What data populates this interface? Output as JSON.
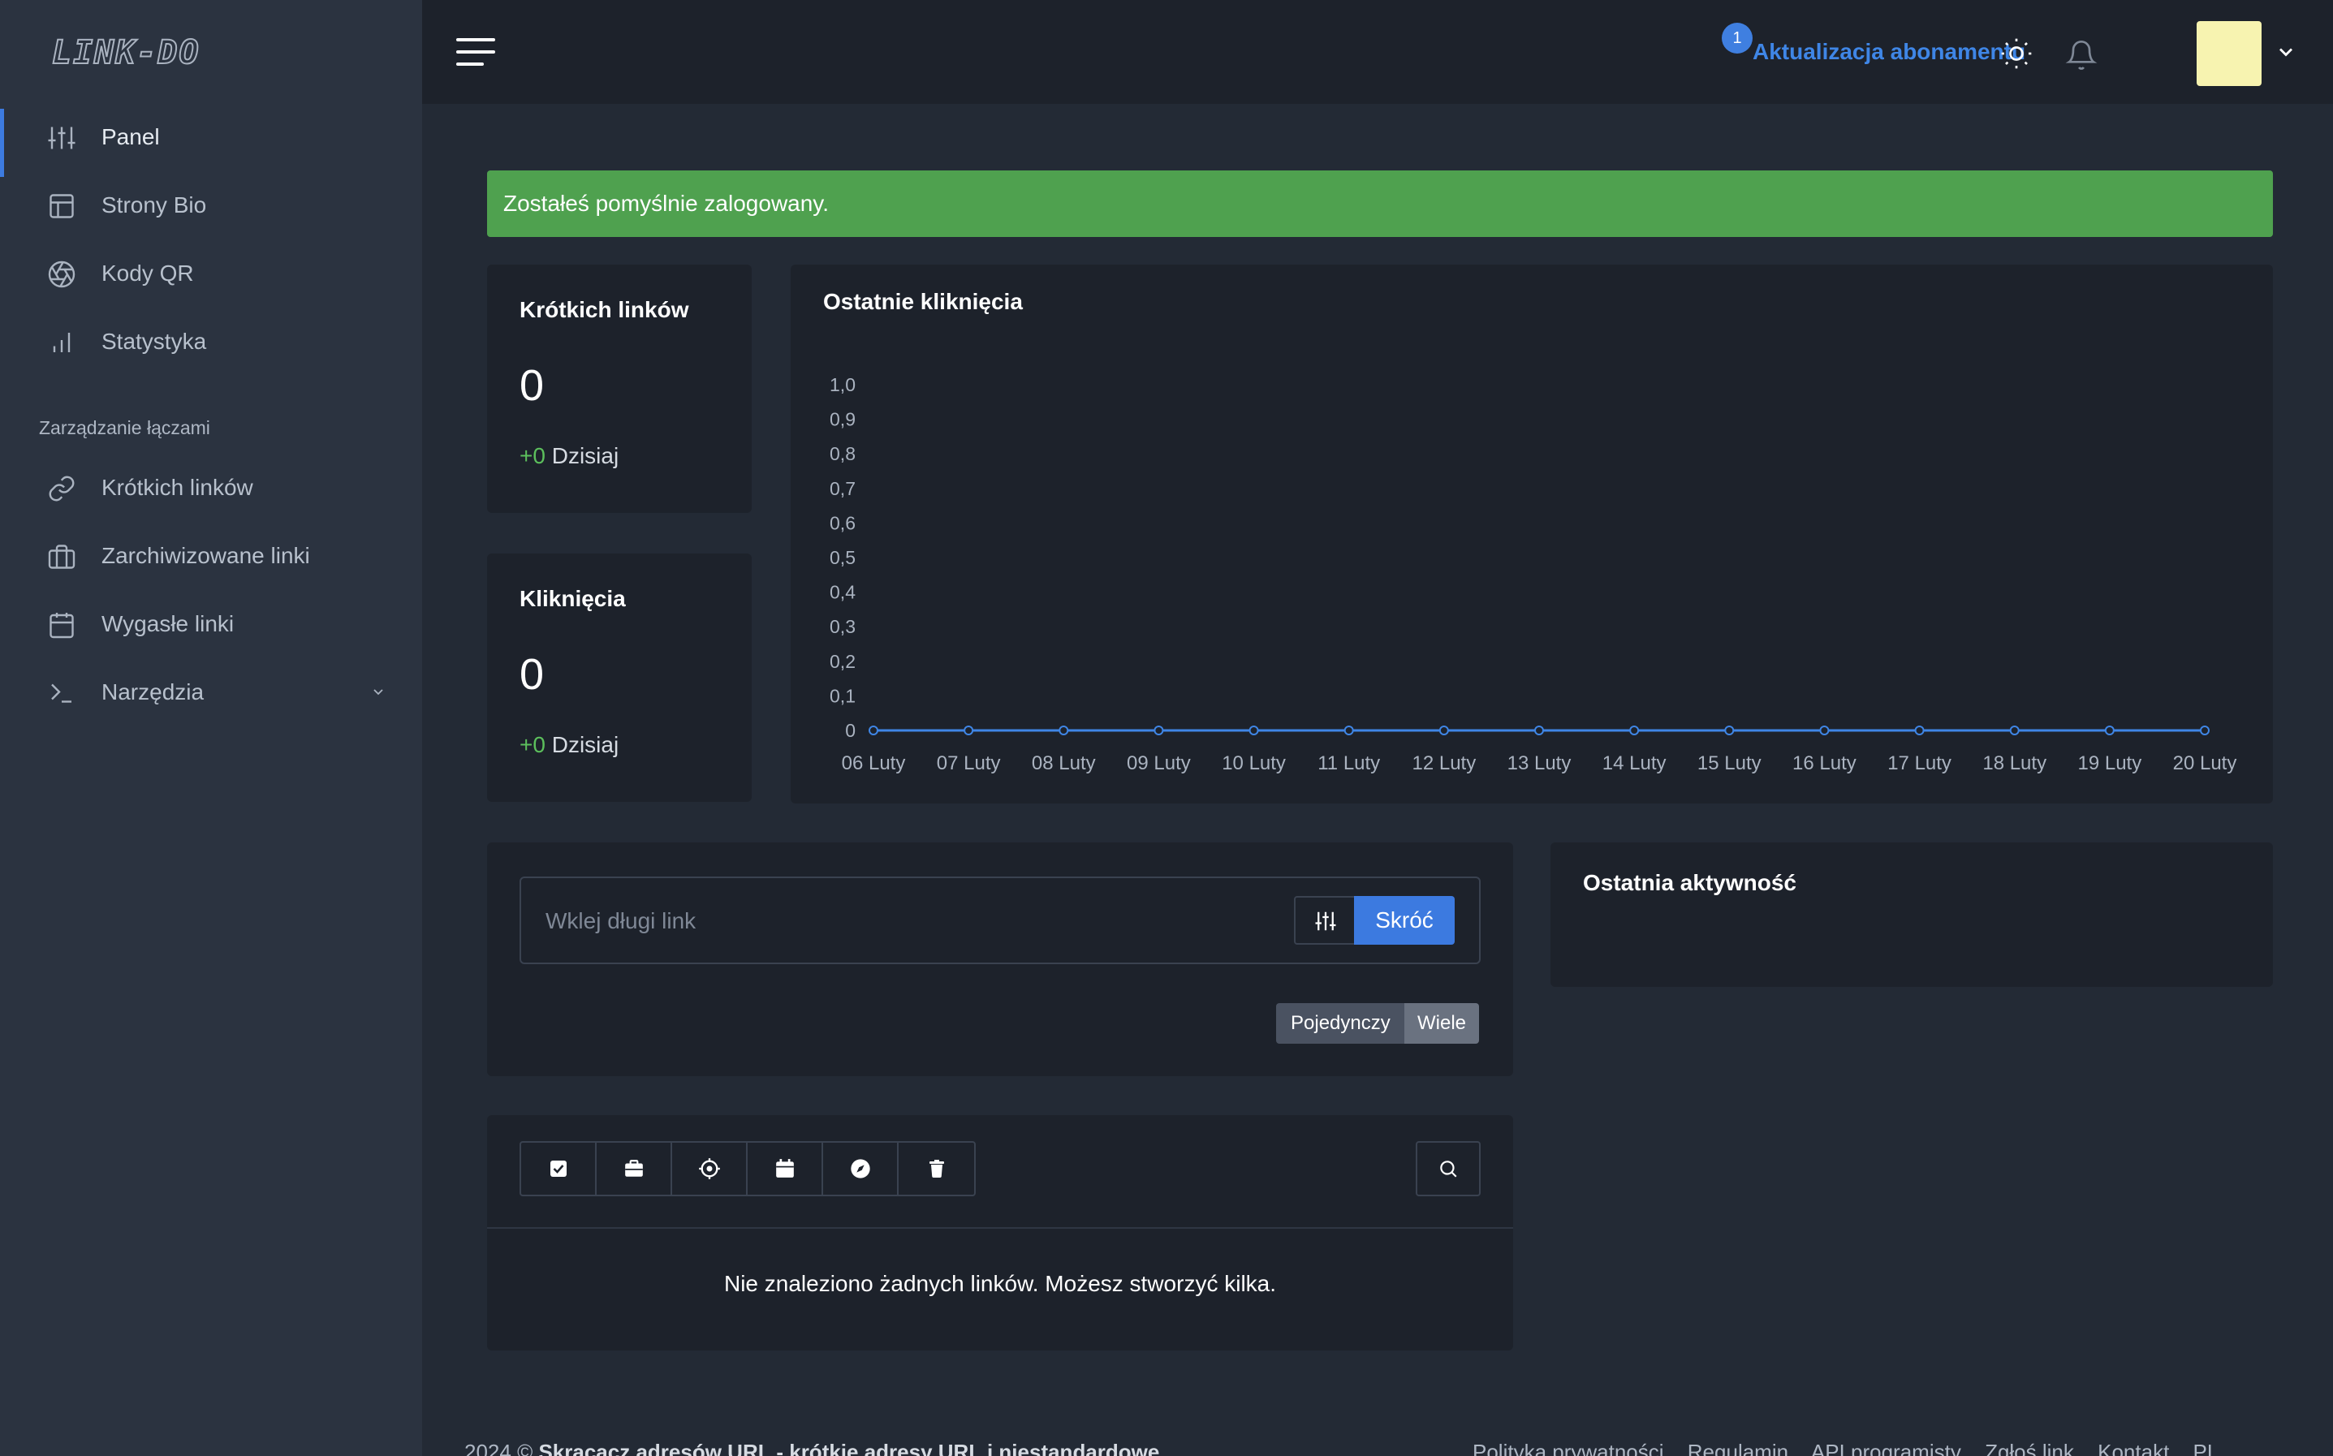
{
  "brand": {
    "logo_text": "LINK-DO"
  },
  "sidebar": {
    "items": [
      {
        "label": "Panel",
        "icon": "sliders-icon"
      },
      {
        "label": "Strony Bio",
        "icon": "layout-icon"
      },
      {
        "label": "Kody QR",
        "icon": "aperture-icon"
      },
      {
        "label": "Statystyka",
        "icon": "bar-chart-icon"
      }
    ],
    "section_title": "Zarządzanie łączami",
    "manage_items": [
      {
        "label": "Krótkich linków",
        "icon": "link-icon"
      },
      {
        "label": "Zarchiwizowane linki",
        "icon": "archive-box-icon"
      },
      {
        "label": "Wygasłe linki",
        "icon": "calendar-icon"
      },
      {
        "label": "Narzędzia",
        "icon": "terminal-icon"
      }
    ]
  },
  "topbar": {
    "upgrade_label": "Aktualizacja abonamentu",
    "notification_count": "1"
  },
  "alert": {
    "message": "Zostałeś pomyślnie zalogowany."
  },
  "stats": [
    {
      "title": "Krótkich linków",
      "value": "0",
      "delta": "+0",
      "delta_label": "Dzisiaj"
    },
    {
      "title": "Kliknięcia",
      "value": "0",
      "delta": "+0",
      "delta_label": "Dzisiaj"
    }
  ],
  "recent_clicks": {
    "title": "Ostatnie kliknięcia"
  },
  "chart_data": {
    "type": "line",
    "title": "Ostatnie kliknięcia",
    "categories": [
      "06 Luty",
      "07 Luty",
      "08 Luty",
      "09 Luty",
      "10 Luty",
      "11 Luty",
      "12 Luty",
      "13 Luty",
      "14 Luty",
      "15 Luty",
      "16 Luty",
      "17 Luty",
      "18 Luty",
      "19 Luty",
      "20 Luty"
    ],
    "series": [
      {
        "values": [
          0,
          0,
          0,
          0,
          0,
          0,
          0,
          0,
          0,
          0,
          0,
          0,
          0,
          0,
          0
        ]
      }
    ],
    "yticks": [
      "0",
      "0,1",
      "0,2",
      "0,3",
      "0,4",
      "0,5",
      "0,6",
      "0,7",
      "0,8",
      "0,9",
      "1,0"
    ],
    "ylim": [
      0,
      1
    ],
    "color": "#3f86e6",
    "grid": false
  },
  "shorten": {
    "placeholder": "Wklej długi link",
    "button_label": "Skróć",
    "mode_single": "Pojedynczy",
    "mode_multiple": "Wiele"
  },
  "recent_activity": {
    "title": "Ostatnia aktywność"
  },
  "links": {
    "empty_message": "Nie znaleziono żadnych linków. Możesz stworzyć kilka."
  },
  "footer": {
    "copyright": "2024 ©",
    "tagline": "Skracacz adresów URL - krótkie adresy URL i niestandardowe",
    "links": [
      "Polityka prywatności",
      "Regulamin",
      "API programisty",
      "Zgłoś link",
      "Kontakt"
    ],
    "language": "PL"
  },
  "colors": {
    "accent": "#3c7ae0",
    "success": "#4fa14f",
    "sidebar": "#2b3340",
    "card": "#1d222b"
  }
}
